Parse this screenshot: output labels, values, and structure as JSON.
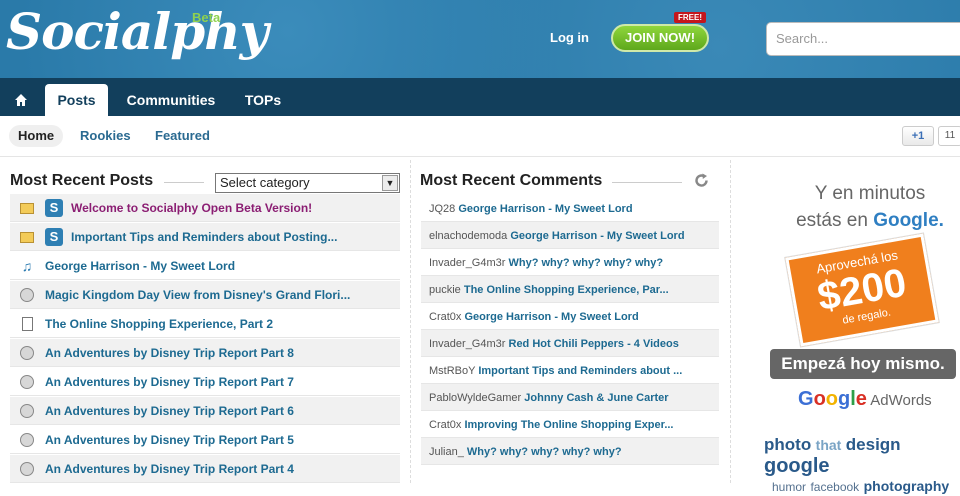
{
  "header": {
    "logo": "Socialphy",
    "beta": "Beta",
    "login": "Log in",
    "join": "JOIN NOW!",
    "free": "FREE!",
    "search_placeholder": "Search..."
  },
  "nav": {
    "home_icon": "home-icon",
    "items": [
      "Posts",
      "Communities",
      "TOPs"
    ]
  },
  "subnav": {
    "items": [
      "Home",
      "Rookies",
      "Featured"
    ],
    "gplus": "+1",
    "gplus_count": "11"
  },
  "posts": {
    "title": "Most Recent Posts",
    "select": "Select category",
    "items": [
      {
        "text": "Welcome to Socialphy Open Beta Version!",
        "icon": "folder-icon"
      },
      {
        "text": "Important Tips and Reminders about Posting...",
        "icon": "folder-icon"
      },
      {
        "text": "George Harrison - My Sweet Lord",
        "icon": "music-note-icon"
      },
      {
        "text": "Magic Kingdom Day View from Disney's Grand Flori...",
        "icon": "compass-icon"
      },
      {
        "text": "The Online Shopping Experience, Part 2",
        "icon": "document-icon"
      },
      {
        "text": "An Adventures by Disney Trip Report Part 8",
        "icon": "compass-icon"
      },
      {
        "text": "An Adventures by Disney Trip Report Part 7",
        "icon": "compass-icon"
      },
      {
        "text": "An Adventures by Disney Trip Report Part 6",
        "icon": "compass-icon"
      },
      {
        "text": "An Adventures by Disney Trip Report Part 5",
        "icon": "compass-icon"
      },
      {
        "text": "An Adventures by Disney Trip Report Part 4",
        "icon": "compass-icon"
      }
    ]
  },
  "comments": {
    "title": "Most Recent Comments",
    "items": [
      {
        "user": "JQ28",
        "title": "George Harrison - My Sweet Lord"
      },
      {
        "user": "elnachodemoda",
        "title": "George Harrison - My Sweet Lord"
      },
      {
        "user": "Invader_G4m3r",
        "title": "Why? why? why? why? why?"
      },
      {
        "user": "puckie",
        "title": "The Online Shopping Experience, Par..."
      },
      {
        "user": "Crat0x",
        "title": "George Harrison - My Sweet Lord"
      },
      {
        "user": "Invader_G4m3r",
        "title": "Red Hot Chili Peppers - 4 Videos"
      },
      {
        "user": "MstRBoY",
        "title": "Important Tips and Reminders about ..."
      },
      {
        "user": "PabloWyldeGamer",
        "title": "Johnny Cash & June Carter"
      },
      {
        "user": "Crat0x",
        "title": "Improving The Online Shopping Exper..."
      },
      {
        "user": "Julian_",
        "title": "Why? why? why? why? why?"
      }
    ]
  },
  "ad": {
    "line1": "Y en minutos",
    "line2a": "estás en ",
    "line2b": "Google.",
    "promo1": "Aprovechá los",
    "promo2": "$200",
    "promo3": "de regalo.",
    "cta": "Empezá hoy mismo.",
    "google": "Google",
    "adwords": " AdWords"
  },
  "tags": {
    "row1": [
      "photo",
      "that",
      "design",
      "google"
    ],
    "row2": [
      "humor",
      "facebook",
      "photography"
    ]
  }
}
